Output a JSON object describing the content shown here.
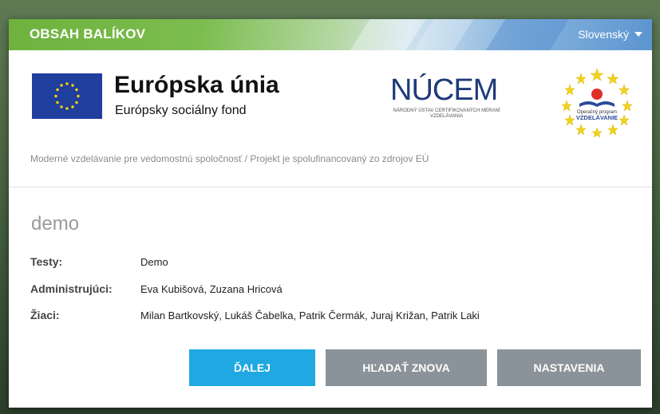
{
  "header": {
    "title": "OBSAH BALÍKOV",
    "language": "Slovenský",
    "colors": {
      "green": "#6eb23e",
      "blue": "#5b95cf"
    }
  },
  "logos": {
    "eu_title": "Európska únia",
    "eu_subtitle": "Európsky sociálny fond",
    "nucem": "NÚCEM",
    "nucem_subtitle": "NÁRODNÝ ÚSTAV CERTIFIKOVANÝCH MERANÍ VZDELÁVANIA",
    "op_line1": "Operačný program",
    "op_line2": "VZDELÁVANIE"
  },
  "breadcrumb": "Moderné vzdelávanie pre vedomostnú spoločnosť / Projekt je spolufinancovaný zo zdrojov EÚ",
  "package": {
    "name": "demo",
    "rows": [
      {
        "label": "Testy:",
        "value": "Demo"
      },
      {
        "label": "Administrujúci:",
        "value": "Eva Kubišová, Zuzana Hricová"
      },
      {
        "label": "Žiaci:",
        "value": "Milan Bartkovský, Lukáš Čabelka, Patrik Čermák, Juraj Križan, Patrik Laki"
      }
    ]
  },
  "buttons": {
    "next": "ĎALEJ",
    "search_again": "HĽADAŤ ZNOVA",
    "settings": "NASTAVENIA",
    "colors": {
      "primary": "#20a8e2",
      "secondary": "#8a9399"
    }
  }
}
